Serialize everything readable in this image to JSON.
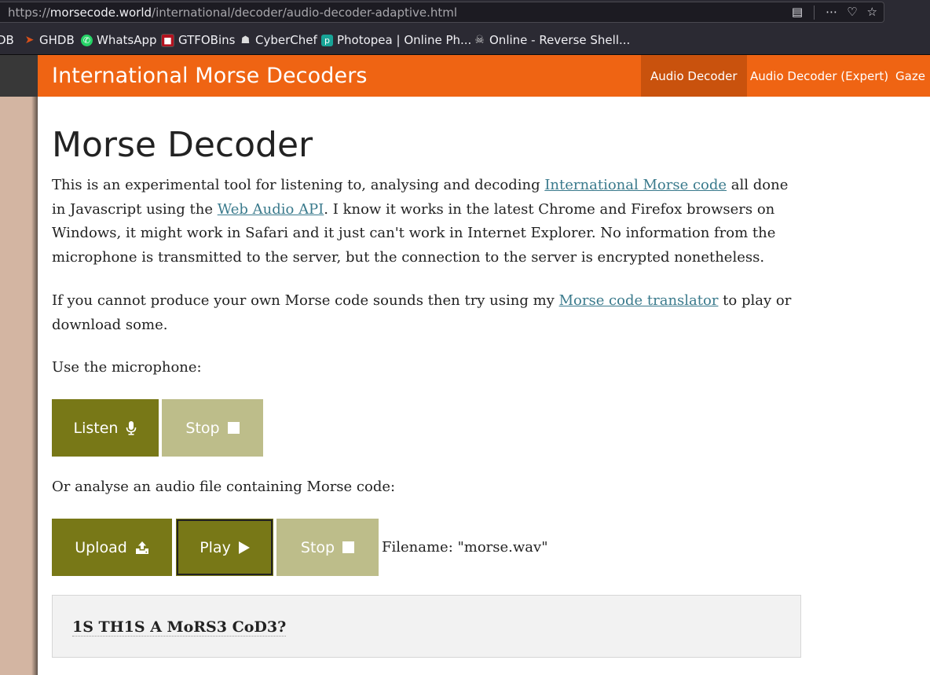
{
  "browser": {
    "url_prefix": "https://",
    "url_host": "morsecode.world",
    "url_path": "/international/decoder/audio-decoder-adaptive.html",
    "bookmarks": [
      {
        "label": "DB",
        "icon": "bookmark-icon",
        "color": "#2b2a33"
      },
      {
        "label": "GHDB",
        "icon": "ghdb-icon",
        "color": "#d9501a"
      },
      {
        "label": "WhatsApp",
        "icon": "whatsapp-icon",
        "color": "#25d366"
      },
      {
        "label": "GTFOBins",
        "icon": "gtfobins-icon",
        "color": "#b3121f"
      },
      {
        "label": "CyberChef",
        "icon": "cyberchef-icon",
        "color": "#dddddd"
      },
      {
        "label": "Photopea | Online Ph...",
        "icon": "photopea-icon",
        "color": "#18a497"
      },
      {
        "label": "Online - Reverse Shell...",
        "icon": "skull-icon",
        "color": "#cccccc"
      }
    ]
  },
  "navbar": {
    "brand": "International Morse Decoders",
    "items": [
      {
        "label": "Audio Decoder",
        "active": true
      },
      {
        "label": "Audio Decoder (Expert)",
        "active": false
      },
      {
        "label": "Gaze D",
        "active": false
      }
    ],
    "color": "#ef6413",
    "active_color": "#c9520d"
  },
  "main": {
    "title": "Morse Decoder",
    "intro": {
      "t1": "This is an experimental tool for listening to, analysing and decoding ",
      "link1": "International Morse code",
      "t2": " all done in Javascript using the ",
      "link2": "Web Audio API",
      "t3": ". I know it works in the latest Chrome and Firefox browsers on Windows, it might work in Safari and it just can't work in Internet Explorer. No information from the microphone is transmitted to the server, but the connection to the server is encrypted nonetheless."
    },
    "translator": {
      "t1": "If you cannot produce your own Morse code sounds then try using my ",
      "link": "Morse code translator",
      "t2": " to play or download some."
    },
    "mic_label": "Use the microphone:",
    "mic_buttons": {
      "listen": "Listen",
      "stop": "Stop"
    },
    "file_label": "Or analyse an audio file containing Morse code:",
    "file_buttons": {
      "upload": "Upload",
      "play": "Play",
      "stop": "Stop"
    },
    "filename": "Filename: \"morse.wav\"",
    "output": "1S TH1S A MoRS3 CoD3?",
    "button_dark": "#787817",
    "button_light": "#bdbd8a"
  }
}
